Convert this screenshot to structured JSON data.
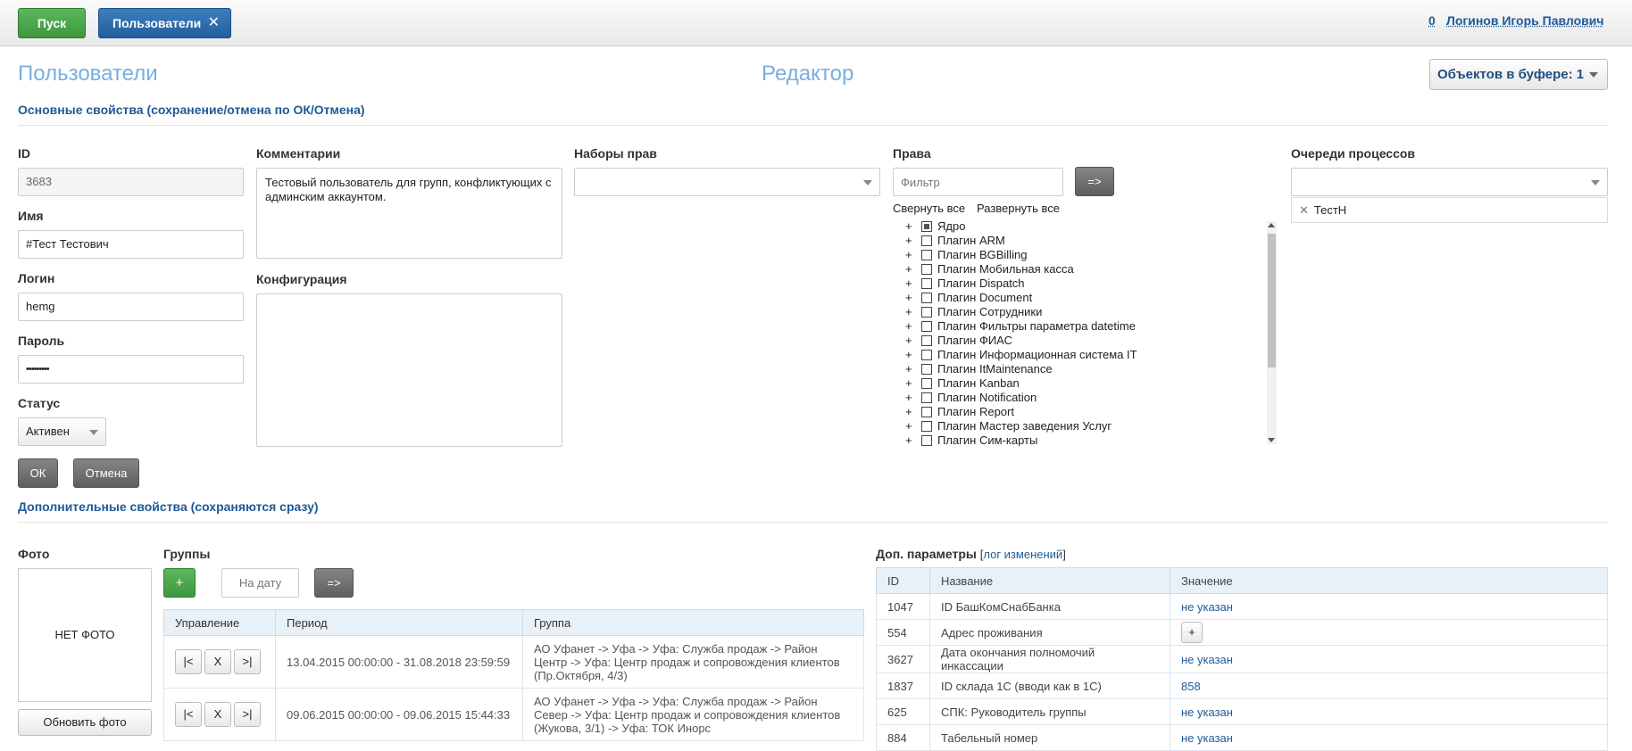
{
  "topbar": {
    "start_label": "Пуск",
    "tab_label": "Пользователи",
    "count": "0",
    "user_name": "Логинов Игорь Павлович"
  },
  "header": {
    "title": "Пользователи",
    "editor_title": "Редактор",
    "buffer_label": "Объектов в буфере: 1"
  },
  "main_section": {
    "title": "Основные свойства (сохранение/отмена по ОК/Отмена)",
    "id_label": "ID",
    "id_value": "3683",
    "name_label": "Имя",
    "name_value": "#Тест Тестович",
    "login_label": "Логин",
    "login_value": "hemg",
    "password_label": "Пароль",
    "password_value": "•••••••••",
    "status_label": "Статус",
    "status_value": "Активен",
    "comments_label": "Комментарии",
    "comments_value": "Тестовый пользователь для групп, конфликтующих с админским аккаунтом.",
    "config_label": "Конфигурация",
    "config_value": "",
    "rightsets_label": "Наборы прав",
    "rightsets_value": "",
    "rights_label": "Права",
    "rights_filter_placeholder": "Фильтр",
    "rights_apply": "=>",
    "collapse_all": "Свернуть все",
    "expand_all": "Развернуть все",
    "rights_tree": [
      {
        "label": "Ядро",
        "partial": true
      },
      {
        "label": "Плагин ARM",
        "partial": false
      },
      {
        "label": "Плагин BGBilling",
        "partial": false
      },
      {
        "label": "Плагин Мобильная касса",
        "partial": false
      },
      {
        "label": "Плагин Dispatch",
        "partial": false
      },
      {
        "label": "Плагин Document",
        "partial": false
      },
      {
        "label": "Плагин Сотрудники",
        "partial": false
      },
      {
        "label": "Плагин Фильтры параметра datetime",
        "partial": false
      },
      {
        "label": "Плагин ФИАС",
        "partial": false
      },
      {
        "label": "Плагин Информационная система IT",
        "partial": false
      },
      {
        "label": "Плагин ItMaintenance",
        "partial": false
      },
      {
        "label": "Плагин Kanban",
        "partial": false
      },
      {
        "label": "Плагин Notification",
        "partial": false
      },
      {
        "label": "Плагин Report",
        "partial": false
      },
      {
        "label": "Плагин Мастер заведения Услуг",
        "partial": false
      },
      {
        "label": "Плагин Сим-карты",
        "partial": false
      }
    ],
    "queues_label": "Очереди процессов",
    "queues_value": "",
    "queue_chip": "ТестН",
    "ok_label": "ОК",
    "cancel_label": "Отмена"
  },
  "extra_section": {
    "title": "Дополнительные свойства (сохраняются сразу)",
    "photo_label": "Фото",
    "no_photo": "НЕТ ФОТО",
    "update_photo": "Обновить фото",
    "groups_label": "Группы",
    "add_label": "+",
    "date_placeholder": "На дату",
    "date_apply": "=>",
    "groups_columns": [
      "Управление",
      "Период",
      "Группа"
    ],
    "groups_rows": [
      {
        "controls": [
          "|<",
          "X",
          ">|"
        ],
        "period": "13.04.2015 00:00:00 - 31.08.2018 23:59:59",
        "group": "АО Уфанет -> Уфа -> Уфа: Служба продаж -> Район Центр -> Уфа: Центр продаж и сопровождения клиентов (Пр.Октября, 4/3)"
      },
      {
        "controls": [
          "|<",
          "X",
          ">|"
        ],
        "period": "09.06.2015 00:00:00 - 09.06.2015 15:44:33",
        "group": "АО Уфанет -> Уфа -> Уфа: Служба продаж -> Район Север -> Уфа: Центр продаж и сопровождения клиентов (Жукова, 3/1) -> Уфа: ТОК Иноpс"
      }
    ],
    "params_label": "Доп. параметры",
    "params_log": "лог изменений",
    "params_columns": [
      "ID",
      "Название",
      "Значение"
    ],
    "params_rows": [
      {
        "id": "1047",
        "name": "ID БашКомСнабБанка",
        "value": "не указан",
        "type": "link"
      },
      {
        "id": "554",
        "name": "Адрес проживания",
        "value": "+",
        "type": "button"
      },
      {
        "id": "3627",
        "name": "Дата окончания полномочий инкассации",
        "value": "не указан",
        "type": "link"
      },
      {
        "id": "1837",
        "name": "ID склада 1С (вводи как в 1С)",
        "value": "858",
        "type": "link"
      },
      {
        "id": "625",
        "name": "СПК: Руководитель группы",
        "value": "не указан",
        "type": "link"
      },
      {
        "id": "884",
        "name": "Табельный номер",
        "value": "не указан",
        "type": "link"
      }
    ]
  }
}
